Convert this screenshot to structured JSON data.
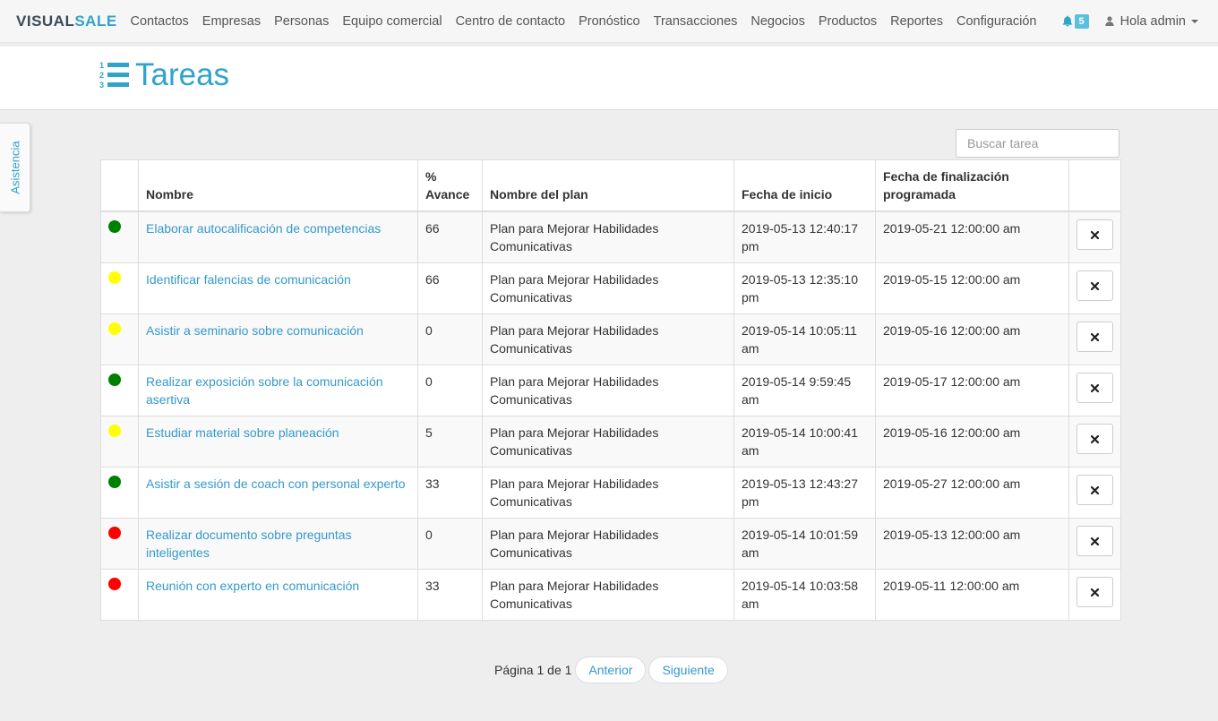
{
  "brand": {
    "prefix": "V",
    "main": "ISUAL",
    "accent": "SALE"
  },
  "nav": {
    "items": [
      "Contactos",
      "Empresas",
      "Personas",
      "Equipo comercial",
      "Centro de contacto",
      "Pronóstico",
      "Transacciones",
      "Negocios",
      "Productos",
      "Reportes",
      "Configuración"
    ],
    "notifications": "5",
    "user_label": "Hola admin"
  },
  "page": {
    "title": "Tareas",
    "side_tab": "Asistencia"
  },
  "search": {
    "placeholder": "Buscar tarea"
  },
  "table": {
    "headers": {
      "status": "",
      "nombre": "Nombre",
      "avance": "% Avance",
      "plan": "Nombre del plan",
      "inicio": "Fecha de inicio",
      "fin": "Fecha de finalización programada",
      "actions": ""
    },
    "rows": [
      {
        "status_color": "#008000",
        "nombre": "Elaborar autocalificación de competencias",
        "avance": "66",
        "plan": "Plan para Mejorar Habilidades Comunicativas",
        "inicio": "2019-05-13 12:40:17 pm",
        "fin": "2019-05-21 12:00:00 am"
      },
      {
        "status_color": "#ffff00",
        "nombre": "Identificar falencias de comunicación",
        "avance": "66",
        "plan": "Plan para Mejorar Habilidades Comunicativas",
        "inicio": "2019-05-13 12:35:10 pm",
        "fin": "2019-05-15 12:00:00 am"
      },
      {
        "status_color": "#ffff00",
        "nombre": "Asistir a seminario sobre comunicación",
        "avance": "0",
        "plan": "Plan para Mejorar Habilidades Comunicativas",
        "inicio": "2019-05-14 10:05:11 am",
        "fin": "2019-05-16 12:00:00 am"
      },
      {
        "status_color": "#008000",
        "nombre": "Realizar exposición sobre la comunicación asertiva",
        "avance": "0",
        "plan": "Plan para Mejorar Habilidades Comunicativas",
        "inicio": "2019-05-14 9:59:45 am",
        "fin": "2019-05-17 12:00:00 am"
      },
      {
        "status_color": "#ffff00",
        "nombre": "Estudiar material sobre planeación",
        "avance": "5",
        "plan": "Plan para Mejorar Habilidades Comunicativas",
        "inicio": "2019-05-14 10:00:41 am",
        "fin": "2019-05-16 12:00:00 am"
      },
      {
        "status_color": "#008000",
        "nombre": "Asistir a sesión de coach con personal experto",
        "avance": "33",
        "plan": "Plan para Mejorar Habilidades Comunicativas",
        "inicio": "2019-05-13 12:43:27 pm",
        "fin": "2019-05-27 12:00:00 am"
      },
      {
        "status_color": "#ff0000",
        "nombre": "Realizar documento sobre preguntas inteligentes",
        "avance": "0",
        "plan": "Plan para Mejorar Habilidades Comunicativas",
        "inicio": "2019-05-14 10:01:59 am",
        "fin": "2019-05-13 12:00:00 am"
      },
      {
        "status_color": "#ff0000",
        "nombre": "Reunión con experto en comunicación",
        "avance": "33",
        "plan": "Plan para Mejorar Habilidades Comunicativas",
        "inicio": "2019-05-14 10:03:58 am",
        "fin": "2019-05-11 12:00:00 am"
      }
    ]
  },
  "pagination": {
    "label": "Página 1 de 1",
    "prev": "Anterior",
    "next": "Siguiente"
  },
  "colors": {
    "accent": "#2fa4c9",
    "link": "#3399cc",
    "badge": "#5bc0de"
  }
}
